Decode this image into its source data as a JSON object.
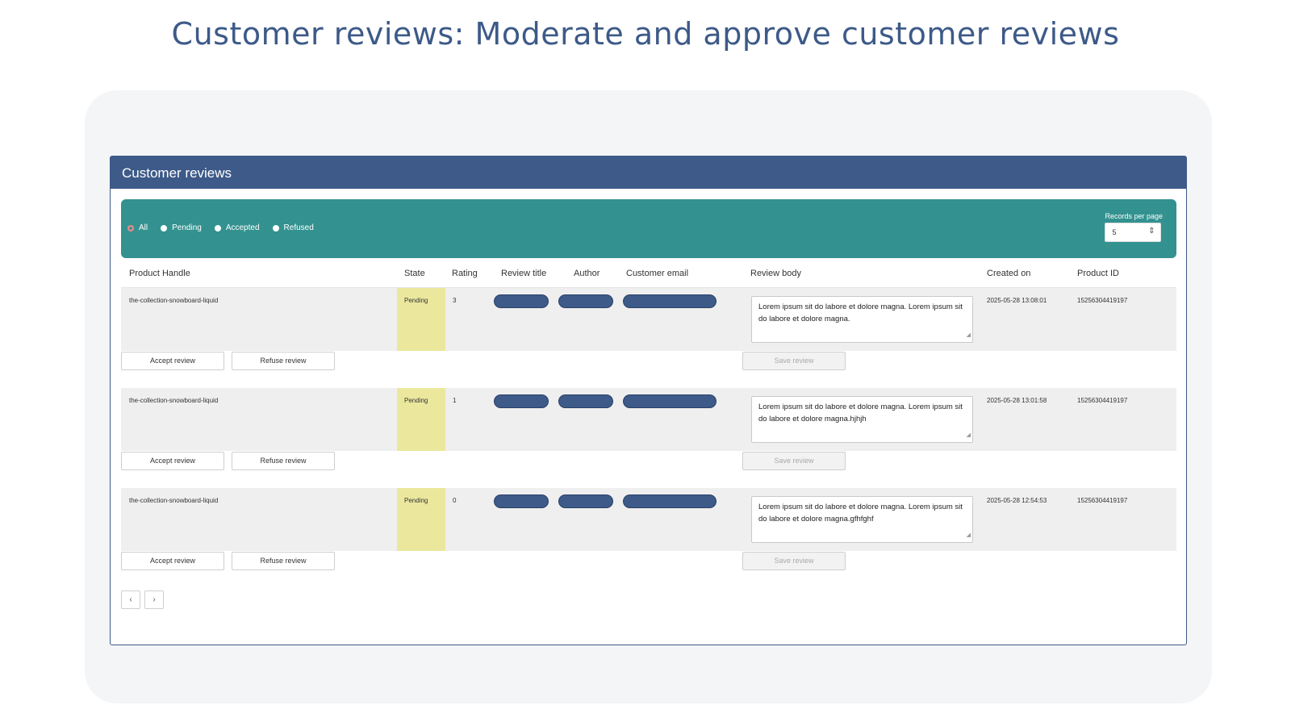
{
  "page_title": "Customer reviews: Moderate and approve customer reviews",
  "app": {
    "title": "Customer reviews"
  },
  "filters": {
    "options": [
      {
        "label": "All",
        "selected": true
      },
      {
        "label": "Pending",
        "selected": false
      },
      {
        "label": "Accepted",
        "selected": false
      },
      {
        "label": "Refused",
        "selected": false
      }
    ],
    "records_label": "Records per page",
    "records_value": "5"
  },
  "columns": {
    "product_handle": "Product Handle",
    "state": "State",
    "rating": "Rating",
    "review_title": "Review title",
    "author": "Author",
    "customer_email": "Customer email",
    "review_body": "Review body",
    "created_on": "Created on",
    "product_id": "Product ID"
  },
  "reviews": [
    {
      "product_handle": "the-collection-snowboard-liquid",
      "state": "Pending",
      "rating": "3",
      "review_body": "Lorem ipsum sit  do  labore et dolore magna. Lorem ipsum sit  do labore et dolore magna.",
      "created_on": "2025-05-28 13:08:01",
      "product_id": "15256304419197"
    },
    {
      "product_handle": "the-collection-snowboard-liquid",
      "state": "Pending",
      "rating": "1",
      "review_body": "Lorem ipsum sit  do  labore et dolore magna. Lorem ipsum sit  do labore et dolore magna.hjhjh",
      "created_on": "2025-05-28 13:01:58",
      "product_id": "15256304419197"
    },
    {
      "product_handle": "the-collection-snowboard-liquid",
      "state": "Pending",
      "rating": "0",
      "review_body": "Lorem ipsum sit  do  labore et dolore magna. Lorem ipsum sit  do labore et dolore magna.gfhfghf",
      "created_on": "2025-05-28 12:54:53",
      "product_id": "15256304419197"
    }
  ],
  "buttons": {
    "accept": "Accept review",
    "refuse": "Refuse review",
    "save": "Save review"
  },
  "pager": {
    "prev": "‹",
    "next": "›"
  },
  "colors": {
    "brand": "#3d5a88",
    "filter_bar": "#339290",
    "pending_state": "#ebe89d",
    "row_band": "#efefef"
  }
}
